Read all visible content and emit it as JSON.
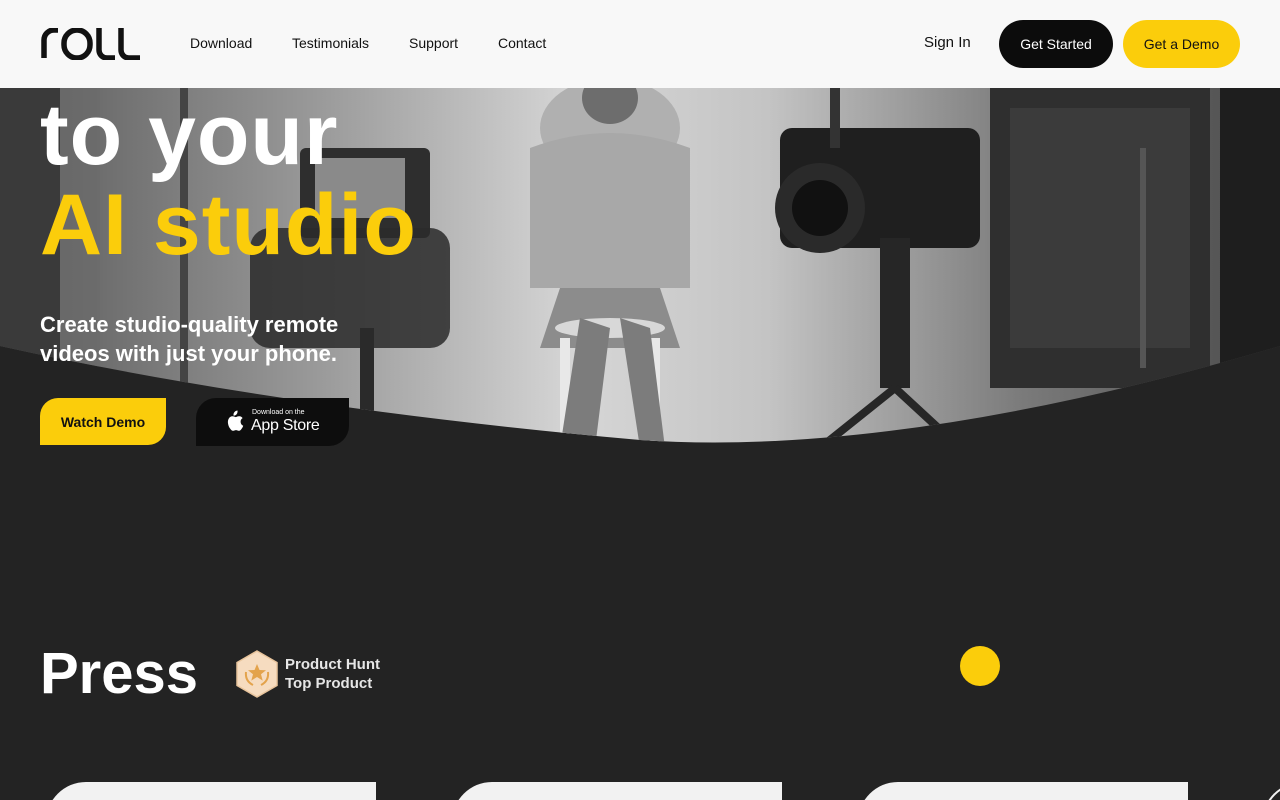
{
  "brand": {
    "logo_text": "roll",
    "accent_color": "#fbcd0b"
  },
  "nav": {
    "links": [
      {
        "label": "Download"
      },
      {
        "label": "Testimonials"
      },
      {
        "label": "Support"
      },
      {
        "label": "Contact"
      }
    ],
    "sign_in": "Sign In",
    "get_started": "Get Started",
    "get_demo": "Get a Demo"
  },
  "hero": {
    "headline_line1": "to your",
    "headline_line2": "AI studio",
    "subheading": "Create studio-quality remote videos with just your phone.",
    "watch_demo": "Watch Demo",
    "app_store_small": "Download on the",
    "app_store_big": "App Store"
  },
  "press": {
    "title": "Press",
    "badge_line1": "Product Hunt",
    "badge_line2": "Top Product"
  }
}
